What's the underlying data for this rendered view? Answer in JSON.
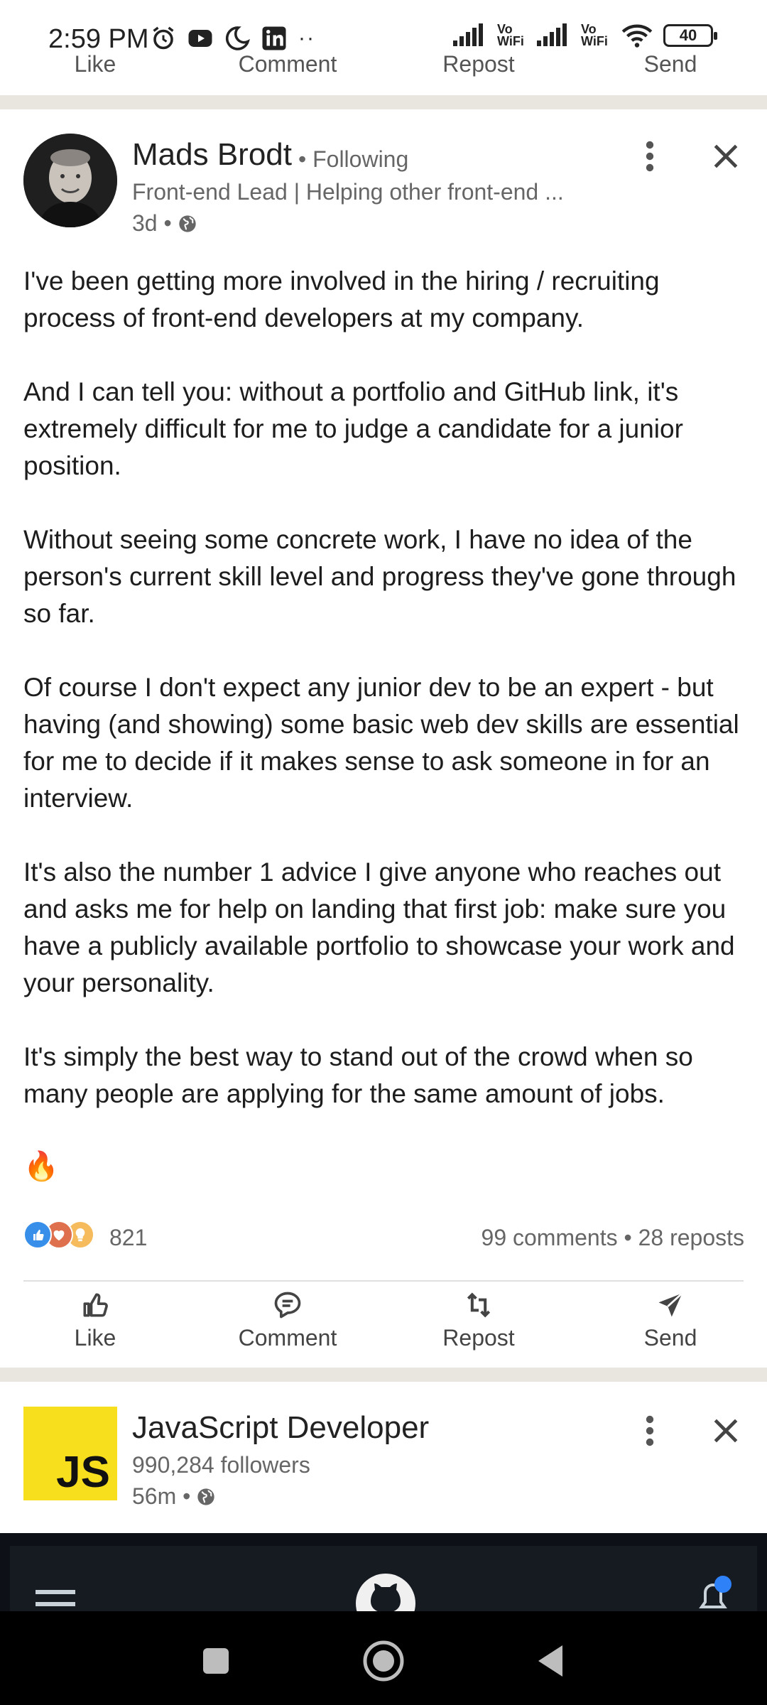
{
  "status_bar": {
    "time": "2:59 PM",
    "dots": "··",
    "vowifi_1": "Vo WiFi",
    "vowifi_2": "Vo WiFi",
    "battery": "40"
  },
  "previous_post": {
    "actions": [
      "Like",
      "Comment",
      "Repost",
      "Send"
    ]
  },
  "post": {
    "author_name": "Mads Brodt",
    "follow_status": "• Following",
    "headline": "Front-end Lead | Helping other front-end ...",
    "time": "3d •",
    "paragraphs": [
      "I've been getting more involved in the hiring / recruiting process of front-end developers at my company.",
      "And I can tell you: without a portfolio and GitHub link, it's extremely difficult for me to judge a candidate for a junior position.",
      "Without seeing some concrete work, I have no idea of the person's current skill level and progress they've gone through so far.",
      "Of course I don't expect any junior dev to be an expert - but having (and showing) some basic web dev skills are essential for me to decide if it makes sense to ask someone in for an interview.",
      "It's also the number 1 advice I give anyone who reaches out and asks me for help on landing that first job: make sure you have a publicly available portfolio to showcase your work and your personality.",
      "It's simply the best way to stand out of the crowd when so many people are applying for the same amount of jobs."
    ],
    "emoji": "🔥",
    "reaction_count": "821",
    "comments_reposts": "99 comments • 28 reposts",
    "actions": {
      "like": "Like",
      "comment": "Comment",
      "repost": "Repost",
      "send": "Send"
    }
  },
  "next_post": {
    "logo_text": "JS",
    "name": "JavaScript Developer",
    "followers": "990,284 followers",
    "time": "56m •"
  },
  "colors": {
    "divider": "#e9e5df",
    "like_blue": "#378fe9",
    "love_red": "#df704d",
    "insight_yellow": "#f5bb5c",
    "js_yellow": "#f7df1e"
  }
}
